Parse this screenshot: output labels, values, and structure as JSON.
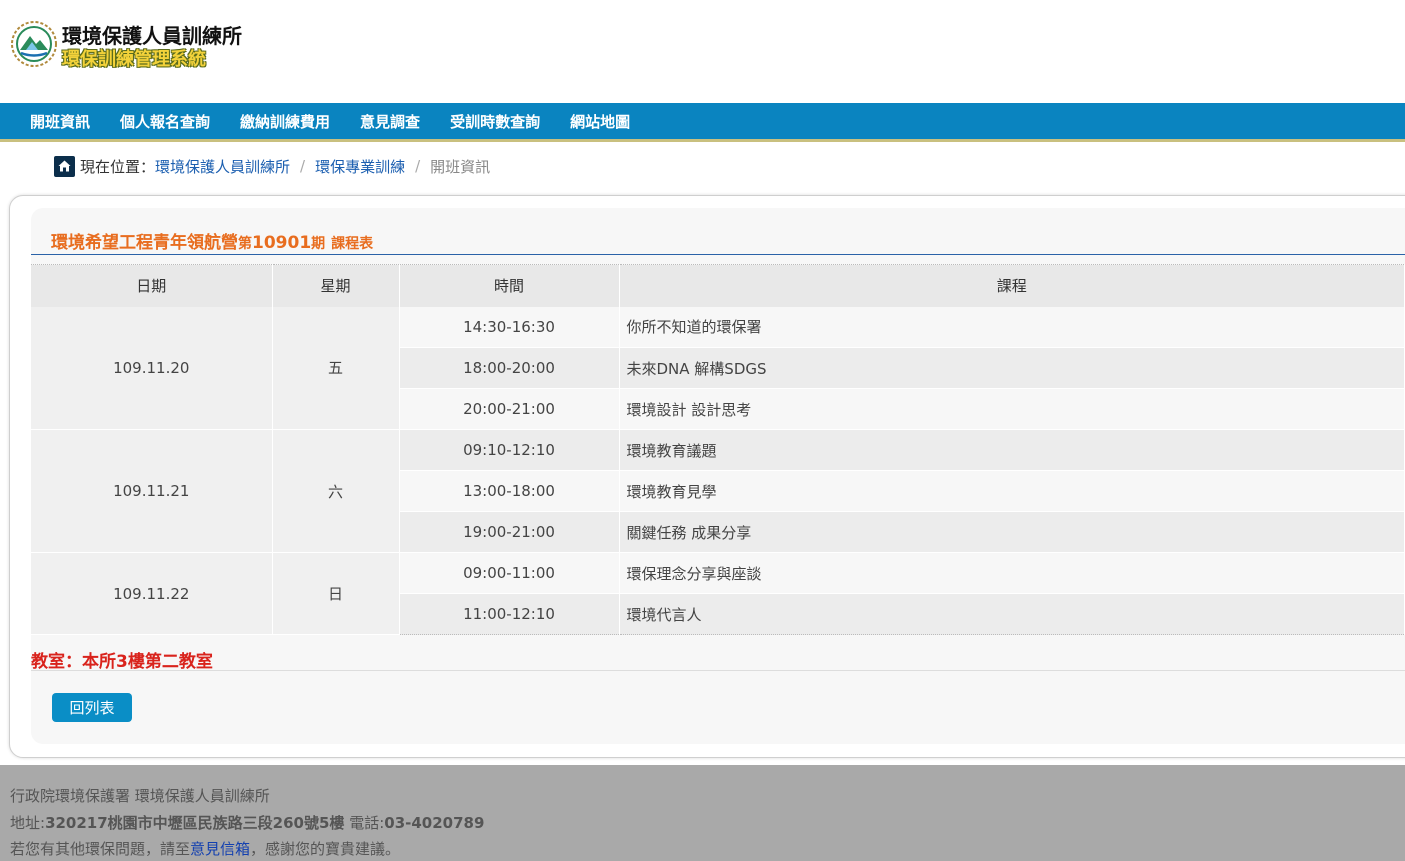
{
  "header": {
    "org_name": "環境保護人員訓練所",
    "system_name": "環保訓練管理系統"
  },
  "nav": {
    "items": [
      {
        "label": "開班資訊"
      },
      {
        "label": "個人報名查詢"
      },
      {
        "label": "繳納訓練費用"
      },
      {
        "label": "意見調查"
      },
      {
        "label": "受訓時數查詢"
      },
      {
        "label": "網站地圖"
      }
    ]
  },
  "breadcrumb": {
    "prefix": "現在位置：",
    "items": [
      {
        "label": "環境保護人員訓練所"
      },
      {
        "label": "環保專業訓練"
      }
    ],
    "separator": "/",
    "current": "開班資訊"
  },
  "course": {
    "title_main": "環境希望工程青年領航營",
    "title_period_prefix": "第",
    "title_period": "10901",
    "title_period_suffix": "期",
    "title_suffix": "課程表"
  },
  "schedule": {
    "headers": {
      "date": "日期",
      "weekday": "星期",
      "time": "時間",
      "course": "課程"
    },
    "days": [
      {
        "date": "109.11.20",
        "weekday": "五",
        "sessions": [
          {
            "time": "14:30-16:30",
            "course": "你所不知道的環保署"
          },
          {
            "time": "18:00-20:00",
            "course": "未來DNA 解構SDGS"
          },
          {
            "time": "20:00-21:00",
            "course": "環境設計 設計思考"
          }
        ]
      },
      {
        "date": "109.11.21",
        "weekday": "六",
        "sessions": [
          {
            "time": "09:10-12:10",
            "course": "環境教育議題"
          },
          {
            "time": "13:00-18:00",
            "course": "環境教育見學"
          },
          {
            "time": "19:00-21:00",
            "course": "關鍵任務 成果分享"
          }
        ]
      },
      {
        "date": "109.11.22",
        "weekday": "日",
        "sessions": [
          {
            "time": "09:00-11:00",
            "course": "環保理念分享與座談"
          },
          {
            "time": "11:00-12:10",
            "course": "環境代言人"
          }
        ]
      }
    ]
  },
  "classroom": "教室：本所3樓第二教室",
  "back_button": "回列表",
  "footer": {
    "line1": "行政院環境保護署 環境保護人員訓練所",
    "address_label": "地址:",
    "address_value": "320217桃園市中壢區民族路三段260號5樓",
    "phone_label": " 電話:",
    "phone_value": "03-4020789",
    "line3_prefix": "若您有其他環保問題，請至",
    "line3_link": "意見信箱",
    "line3_suffix": "，感謝您的寶貴建議。"
  },
  "colors": {
    "nav_bg": "#0a84c0",
    "title_orange": "#e86d1f",
    "classroom_red": "#d9231c",
    "button_blue": "#0a8ec6",
    "footer_bg": "#a9a9a9"
  }
}
